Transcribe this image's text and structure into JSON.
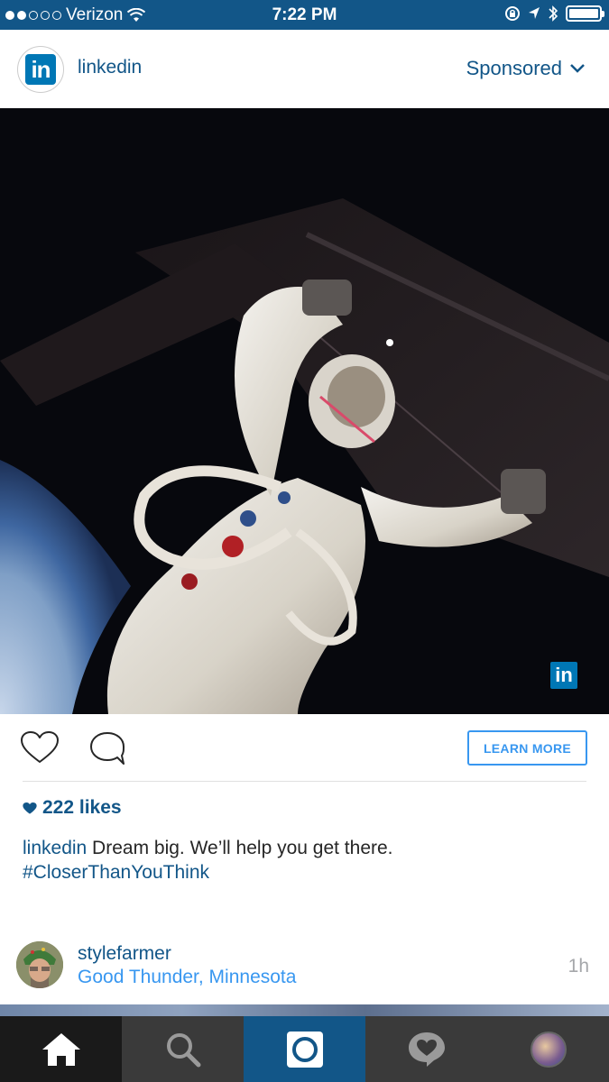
{
  "status_bar": {
    "carrier": "Verizon",
    "time": "7:22 PM",
    "signal_bars_filled": 2,
    "signal_bars_total": 5,
    "battery_level": 1.0
  },
  "post": {
    "username": "linkedin",
    "sponsored_label": "Sponsored",
    "avatar_icon": "linkedin-logo-icon",
    "photo_watermark": "in",
    "learn_more_label": "LEARN MORE",
    "likes_count": "222 likes",
    "caption_user": "linkedin",
    "caption_text": " Dream big. We’ll help you get there.",
    "caption_hashtag": "#CloserThanYouThink"
  },
  "next_post": {
    "username": "stylefarmer",
    "location": "Good Thunder, Minnesota",
    "time_ago": "1h"
  },
  "tab_bar": {
    "items": [
      "home-icon",
      "search-icon",
      "camera-icon",
      "activity-icon",
      "profile-icon"
    ],
    "active": "home"
  },
  "colors": {
    "brand_blue": "#125688",
    "link_blue": "#3897f0",
    "linkedin_blue": "#0077b5"
  }
}
